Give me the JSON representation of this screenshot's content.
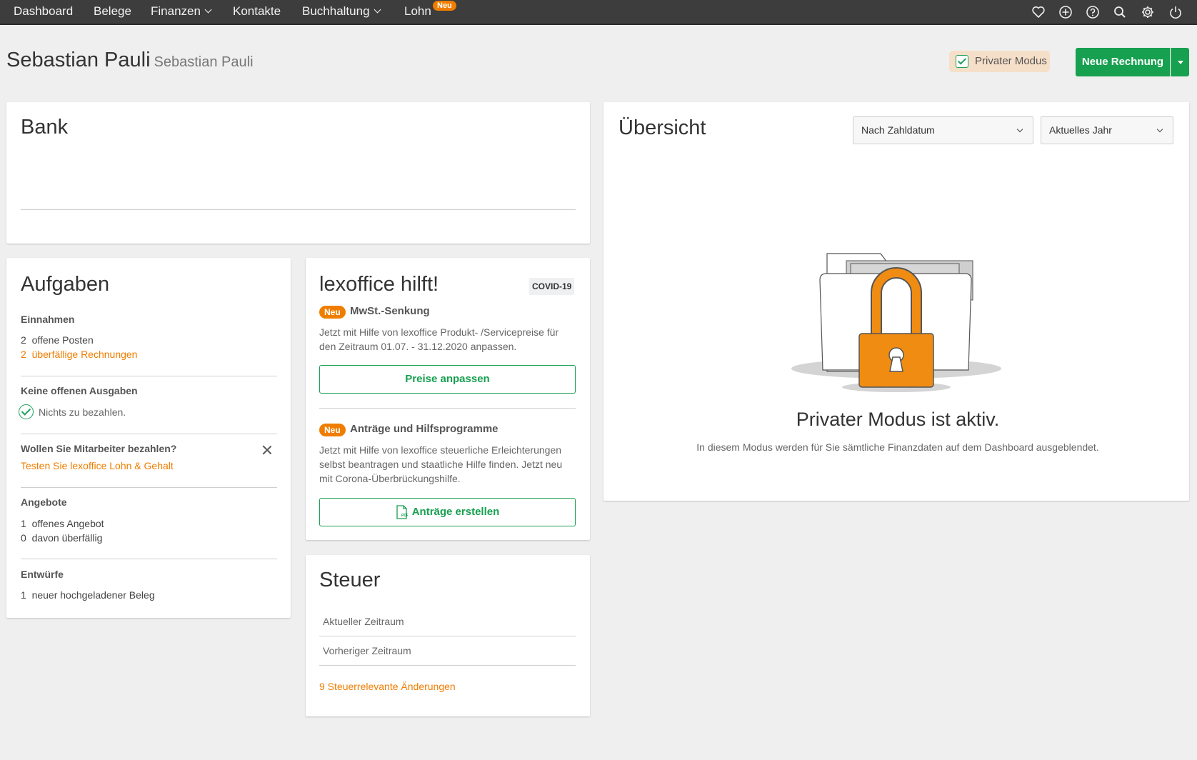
{
  "nav": {
    "items": [
      {
        "label": "Dashboard",
        "dropdown": false
      },
      {
        "label": "Belege",
        "dropdown": false
      },
      {
        "label": "Finanzen",
        "dropdown": true
      },
      {
        "label": "Kontakte",
        "dropdown": false
      },
      {
        "label": "Buchhaltung",
        "dropdown": true
      },
      {
        "label": "Lohn",
        "dropdown": false,
        "badge": "Neu"
      }
    ],
    "icons": [
      "heart-icon",
      "plus-circle-icon",
      "help-icon",
      "search-icon",
      "gear-icon",
      "power-icon"
    ]
  },
  "header": {
    "title": "Sebastian Pauli",
    "subtitle": "Sebastian Pauli",
    "private_mode_label": "Privater Modus",
    "private_mode_checked": true,
    "new_invoice_label": "Neue Rechnung"
  },
  "bank": {
    "title": "Bank"
  },
  "tasks": {
    "title": "Aufgaben",
    "income": {
      "title": "Einnahmen",
      "open_count": "2",
      "open_label": "offene Posten",
      "overdue_count": "2",
      "overdue_label": "überfällige Rechnungen"
    },
    "expenses": {
      "title": "Keine offenen Ausgaben",
      "status": "Nichts zu bezahlen."
    },
    "employees": {
      "title": "Wollen Sie Mitarbeiter bezahlen?",
      "link": "Testen Sie lexoffice Lohn & Gehalt"
    },
    "offers": {
      "title": "Angebote",
      "open_count": "1",
      "open_label": "offenes Angebot",
      "overdue_count": "0",
      "overdue_label": "davon überfällig"
    },
    "drafts": {
      "title": "Entwürfe",
      "count": "1",
      "label": "neuer hochgeladener Beleg"
    }
  },
  "help": {
    "title": "lexoffice hilft!",
    "tag": "COVID-19",
    "badge": "Neu",
    "item1": {
      "title": "MwSt.-Senkung",
      "text": "Jetzt mit Hilfe von lexoffice Produkt- /Servicepreise für den Zeitraum 01.07. - 31.12.2020 anpassen.",
      "button": "Preise anpassen"
    },
    "item2": {
      "title": "Anträge und Hilfsprogramme",
      "text": "Jetzt mit Hilfe von lexoffice steuerliche Erleichterungen selbst beantragen und staatliche Hilfe finden. Jetzt neu mit Corona-Überbrückungshilfe.",
      "button": "Anträge erstellen"
    }
  },
  "tax": {
    "title": "Steuer",
    "current": "Aktueller Zeitraum",
    "previous": "Vorheriger Zeitraum",
    "changes_link": "9 Steuerrelevante Änderungen"
  },
  "overview": {
    "title": "Übersicht",
    "filter_date": "Nach Zahldatum",
    "filter_period": "Aktuelles Jahr",
    "private_title": "Privater Modus ist aktiv.",
    "private_desc": "In diesem Modus werden für Sie sämtliche Finanzdaten auf dem Dashboard ausgeblendet."
  },
  "colors": {
    "nav_bg": "#3d3d3d",
    "accent_green": "#17a050",
    "accent_orange": "#ef7d00",
    "private_toggle_bg": "#f6dfc9",
    "page_bg": "#efefef"
  }
}
